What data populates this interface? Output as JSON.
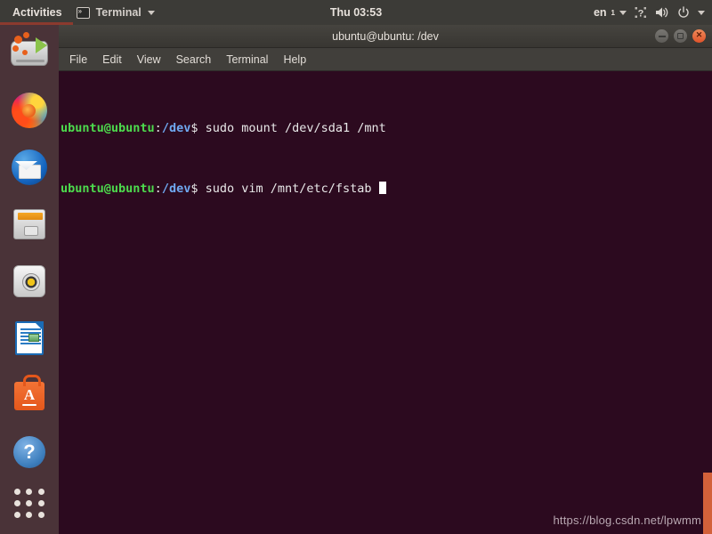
{
  "topbar": {
    "activities": "Activities",
    "app_name": "Terminal",
    "app_icon": "terminal-icon",
    "clock": "Thu 03:53",
    "language": "en",
    "language_sub": "1",
    "icons": [
      "accessibility-icon",
      "volume-icon",
      "power-icon",
      "chevron-down-icon"
    ]
  },
  "dock": {
    "items": [
      {
        "name": "install-ubuntu",
        "icon": "disk-installer-icon"
      },
      {
        "name": "firefox",
        "icon": "firefox-icon"
      },
      {
        "name": "thunderbird",
        "icon": "thunderbird-mail-icon"
      },
      {
        "name": "files",
        "icon": "file-cabinet-icon"
      },
      {
        "name": "rhythmbox",
        "icon": "speaker-icon"
      },
      {
        "name": "libreoffice-writer",
        "icon": "document-icon"
      },
      {
        "name": "ubuntu-software",
        "icon": "shopping-bag-a-icon"
      },
      {
        "name": "help",
        "icon": "question-mark-icon"
      }
    ],
    "app_grid_label": "Show Applications"
  },
  "window": {
    "title": "ubuntu@ubuntu: /dev",
    "buttons": {
      "minimize": "–",
      "maximize": "□",
      "close": "✕"
    },
    "menu": [
      "File",
      "Edit",
      "View",
      "Search",
      "Terminal",
      "Help"
    ]
  },
  "terminal": {
    "colors": {
      "background": "#2c0a1f",
      "prompt_user": "#4ddb4d",
      "prompt_path": "#6fa8f0",
      "text": "#e8e8e8"
    },
    "lines": [
      {
        "user": "ubuntu@ubuntu",
        "sep": ":",
        "path": "/dev",
        "sigil": "$",
        "command": " sudo mount /dev/sda1 /mnt",
        "cursor": false
      },
      {
        "user": "ubuntu@ubuntu",
        "sep": ":",
        "path": "/dev",
        "sigil": "$",
        "command": " sudo vim /mnt/etc/fstab ",
        "cursor": true
      }
    ]
  },
  "watermark": "https://blog.csdn.net/lpwmm"
}
